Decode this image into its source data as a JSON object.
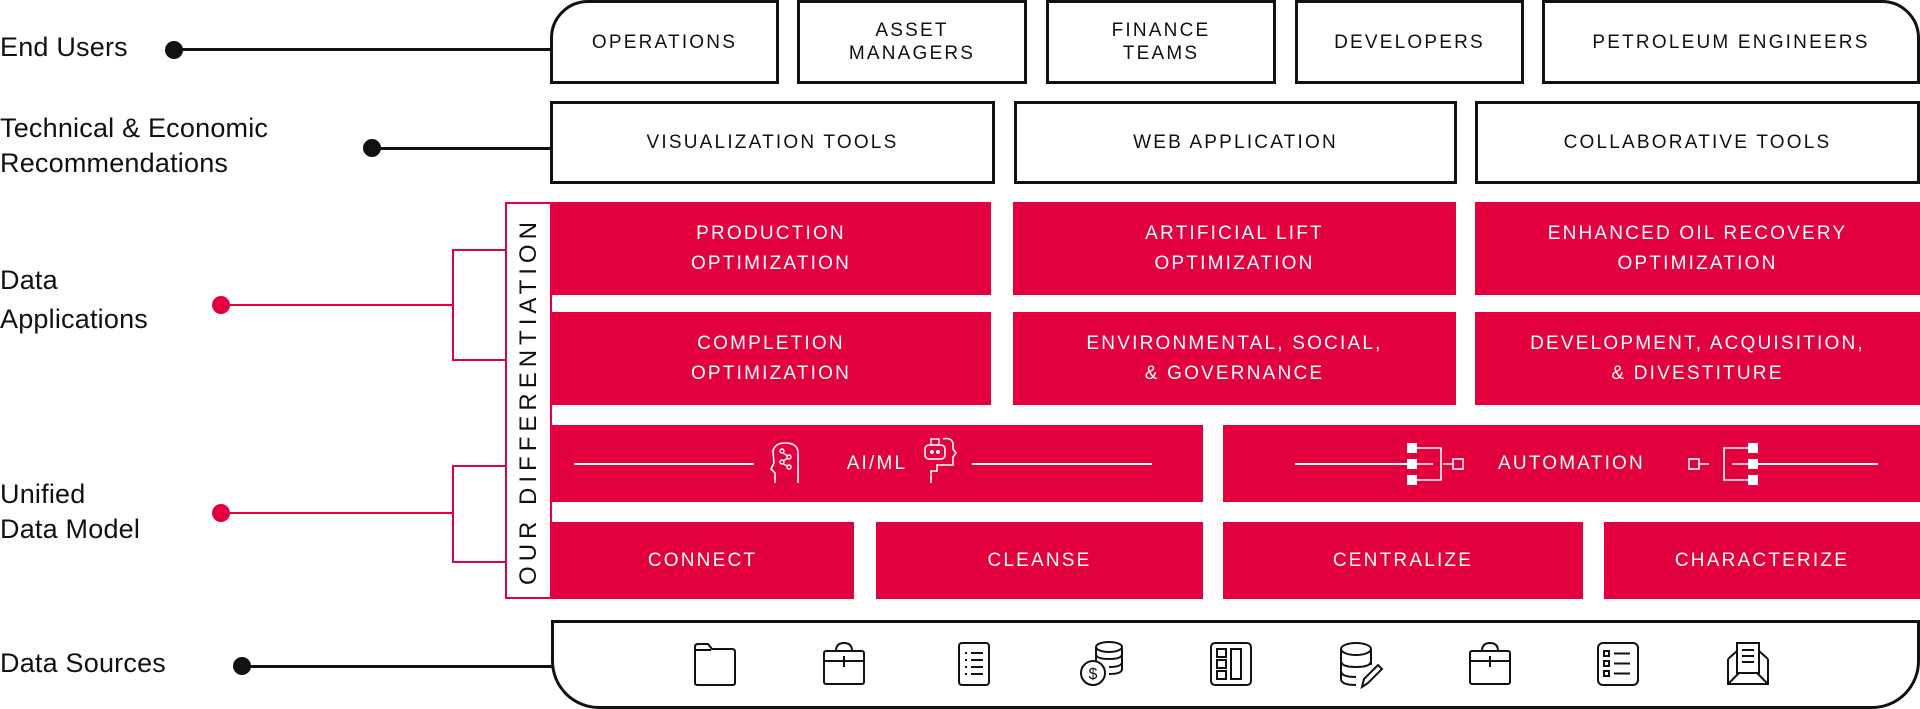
{
  "colors": {
    "accent": "#e3003f",
    "ink": "#111111",
    "background": "#ffffff"
  },
  "layers": {
    "end_users": {
      "label": "End Users",
      "items": [
        "OPERATIONS",
        "ASSET\nMANAGERS",
        "FINANCE\nTEAMS",
        "DEVELOPERS",
        "PETROLEUM ENGINEERS"
      ]
    },
    "recommendations": {
      "label_line1": "Technical & Economic",
      "label_line2": "Recommendations",
      "items": [
        "VISUALIZATION TOOLS",
        "WEB APPLICATION",
        "COLLABORATIVE TOOLS"
      ]
    },
    "data_applications": {
      "label_line1": "Data",
      "label_line2": "Applications",
      "items": [
        "PRODUCTION\nOPTIMIZATION",
        "ARTIFICIAL LIFT\nOPTIMIZATION",
        "ENHANCED OIL RECOVERY\nOPTIMIZATION",
        "COMPLETION\nOPTIMIZATION",
        "ENVIRONMENTAL, SOCIAL,\n& GOVERNANCE",
        "DEVELOPMENT, ACQUISITION,\n& DIVESTITURE"
      ]
    },
    "unified_data_model": {
      "label_line1": "Unified",
      "label_line2": "Data Model",
      "capabilities": [
        "AI/ML",
        "AUTOMATION"
      ],
      "steps": [
        "CONNECT",
        "CLEANSE",
        "CENTRALIZE",
        "CHARACTERIZE"
      ]
    },
    "data_sources": {
      "label": "Data Sources",
      "icons": [
        "folder-icon",
        "briefcase-icon",
        "document-list-icon",
        "coins-database-icon",
        "dashboard-layout-icon",
        "database-edit-icon",
        "briefcase-icon",
        "checklist-icon",
        "envelope-document-icon"
      ]
    }
  },
  "differentiation": {
    "label": "OUR DIFFERENTIATION"
  }
}
